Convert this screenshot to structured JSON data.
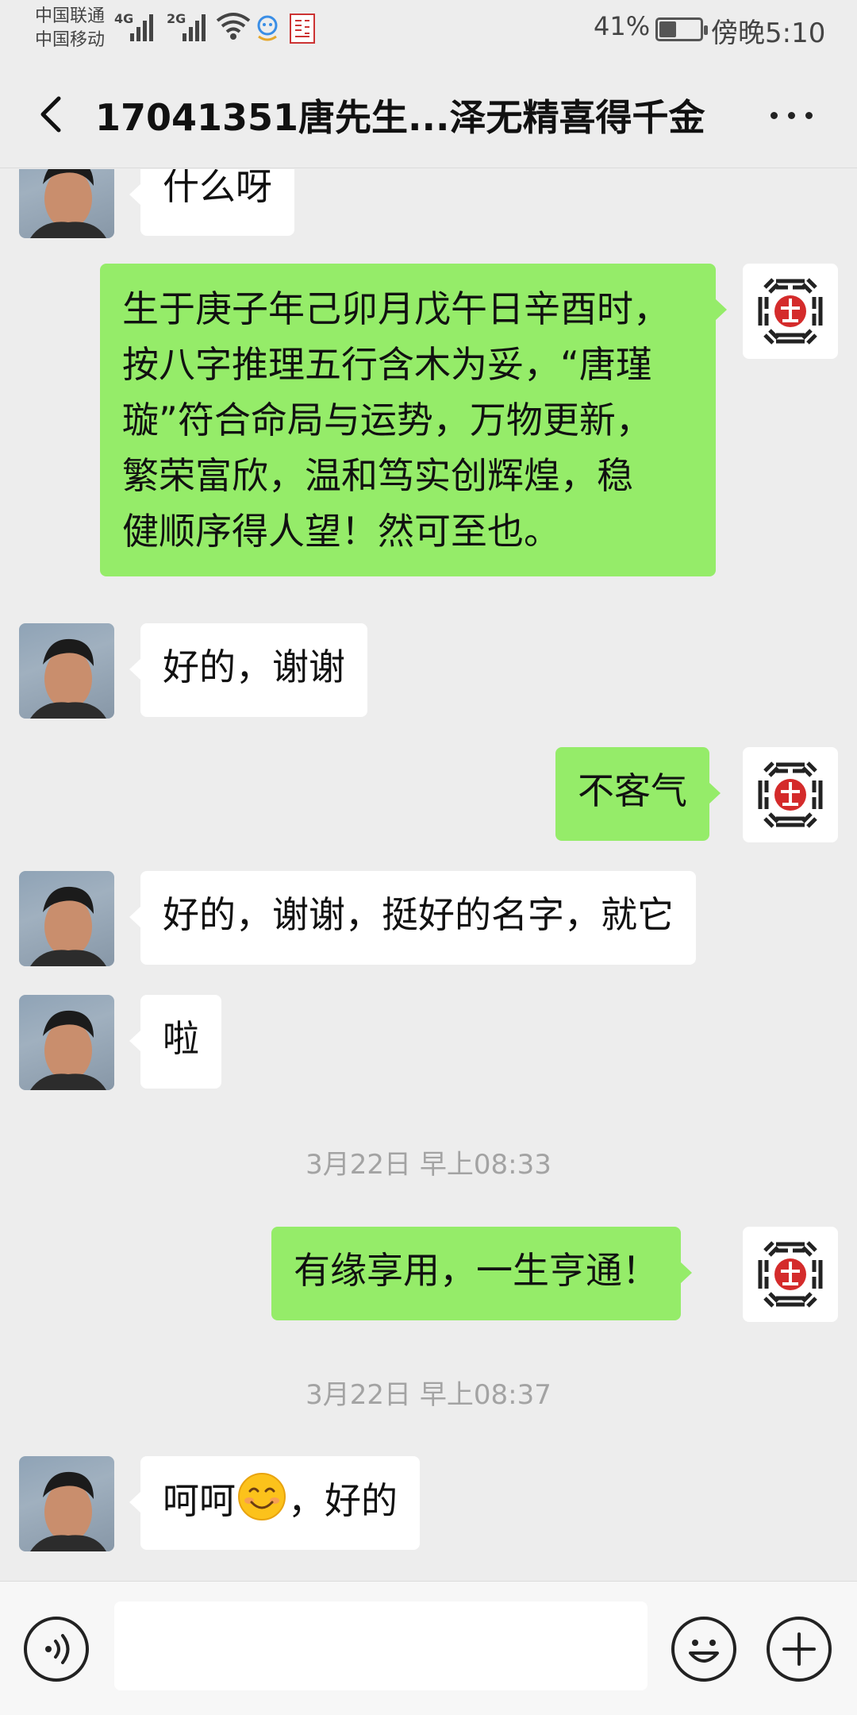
{
  "status_bar": {
    "carrier_1": "中国联通",
    "carrier_2": "中国移动",
    "network_1": "4G",
    "network_2": "2G",
    "battery_percent": "41%",
    "battery_level": 0.41,
    "time": "傍晚5:10",
    "icons": [
      "signal-icon",
      "wifi-icon",
      "notification-bot-icon",
      "seal-app-icon",
      "battery-icon"
    ]
  },
  "header": {
    "back_icon": "chevron-left-icon",
    "title": "17041351唐先生...泽无精喜得千金",
    "more_icon": "more-dots-icon"
  },
  "messages": [
    {
      "sender": "customer",
      "text": "什么呀"
    },
    {
      "sender": "master",
      "lines": [
        "生于庚子年己卯月戊午日辛酉时，",
        "按八字推理五行含木为妥，“唐瑾",
        "璇”符合命局与运势，万物更新，",
        "繁荣富欣，温和笃实创辉煌，稳",
        "健顺序得人望！然可至也。"
      ]
    },
    {
      "sender": "customer",
      "text": "好的，谢谢"
    },
    {
      "sender": "master",
      "text": "不客气"
    },
    {
      "sender": "customer",
      "text": "好的，谢谢，挺好的名字，就它"
    },
    {
      "sender": "customer",
      "text": "啦"
    },
    {
      "type": "timestamp",
      "text": "3月22日 早上08:33"
    },
    {
      "sender": "master",
      "text": "有缘享用，一生亨通！"
    },
    {
      "type": "timestamp",
      "text": "3月22日 早上08:37"
    },
    {
      "sender": "customer",
      "text_before": "呵呵",
      "emoji": "smile-emoji",
      "text_after": "，好的"
    }
  ],
  "input_bar": {
    "voice_icon": "voice-icon",
    "placeholder": "",
    "emoji_icon": "emoji-icon",
    "plus_icon": "plus-icon"
  },
  "colors": {
    "background": "#ededed",
    "outgoing_bubble": "#95ec69",
    "incoming_bubble": "#ffffff",
    "timestamp_text": "#a3a3a3"
  }
}
